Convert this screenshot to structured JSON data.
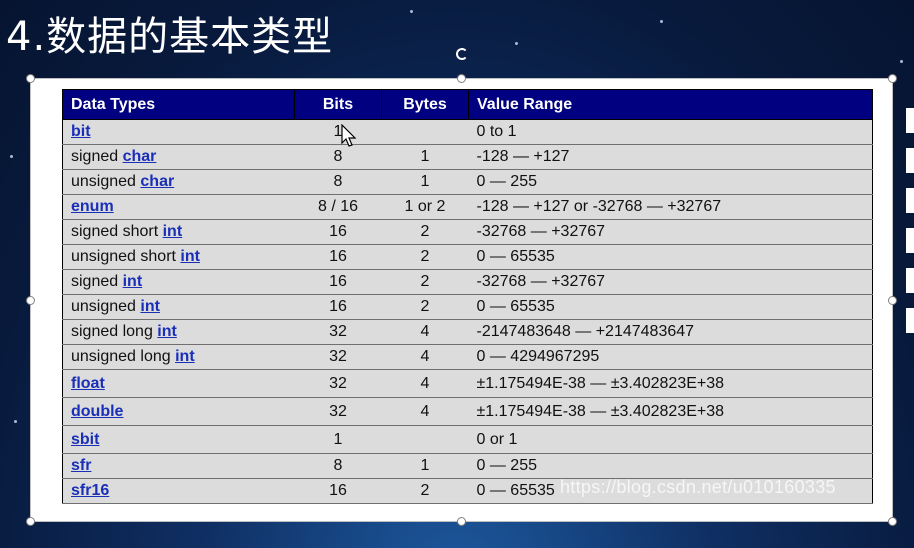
{
  "slide": {
    "title": "4.数据的基本类型",
    "watermark": "https://blog.csdn.net/u010160335"
  },
  "table": {
    "headers": [
      "Data Types",
      "Bits",
      "Bytes",
      "Value Range"
    ],
    "rows": [
      {
        "prefix": "",
        "kw": "bit",
        "bits": "1",
        "bytes": "",
        "range": "0 to 1"
      },
      {
        "prefix": "signed ",
        "kw": "char",
        "bits": "8",
        "bytes": "1",
        "range": "-128 — +127"
      },
      {
        "prefix": "unsigned ",
        "kw": "char",
        "bits": "8",
        "bytes": "1",
        "range": "0 — 255"
      },
      {
        "prefix": "",
        "kw": "enum",
        "bits": "8 / 16",
        "bytes": "1 or 2",
        "range": "-128 — +127 or -32768 — +32767"
      },
      {
        "prefix": "signed short ",
        "kw": "int",
        "bits": "16",
        "bytes": "2",
        "range": "-32768 — +32767"
      },
      {
        "prefix": "unsigned short ",
        "kw": "int",
        "bits": "16",
        "bytes": "2",
        "range": "0 — 65535"
      },
      {
        "prefix": "signed ",
        "kw": "int",
        "bits": "16",
        "bytes": "2",
        "range": "-32768 — +32767"
      },
      {
        "prefix": "unsigned ",
        "kw": "int",
        "bits": "16",
        "bytes": "2",
        "range": "0 — 65535"
      },
      {
        "prefix": "signed long ",
        "kw": "int",
        "bits": "32",
        "bytes": "4",
        "range": "-2147483648 — +2147483647"
      },
      {
        "prefix": "unsigned long ",
        "kw": "int",
        "bits": "32",
        "bytes": "4",
        "range": "0 — 4294967295"
      },
      {
        "prefix": "",
        "kw": "float",
        "bits": "32",
        "bytes": "4",
        "range": "±1.175494E-38 — ±3.402823E+38"
      },
      {
        "prefix": "",
        "kw": "double",
        "bits": "32",
        "bytes": "4",
        "range": "±1.175494E-38 — ±3.402823E+38"
      },
      {
        "prefix": "",
        "kw": "sbit",
        "bits": "1",
        "bytes": "",
        "range": "0 or 1"
      },
      {
        "prefix": "",
        "kw": "sfr",
        "bits": "8",
        "bytes": "1",
        "range": "0 — 255"
      },
      {
        "prefix": "",
        "kw": "sfr16",
        "bits": "16",
        "bytes": "2",
        "range": "0 — 65535"
      }
    ]
  },
  "colors": {
    "header_bg": "#000080",
    "row_bg": "#dcdcdc",
    "link": "#1a2fb8"
  },
  "icons": [
    "rotate-handle-icon",
    "move-cursor-icon"
  ]
}
